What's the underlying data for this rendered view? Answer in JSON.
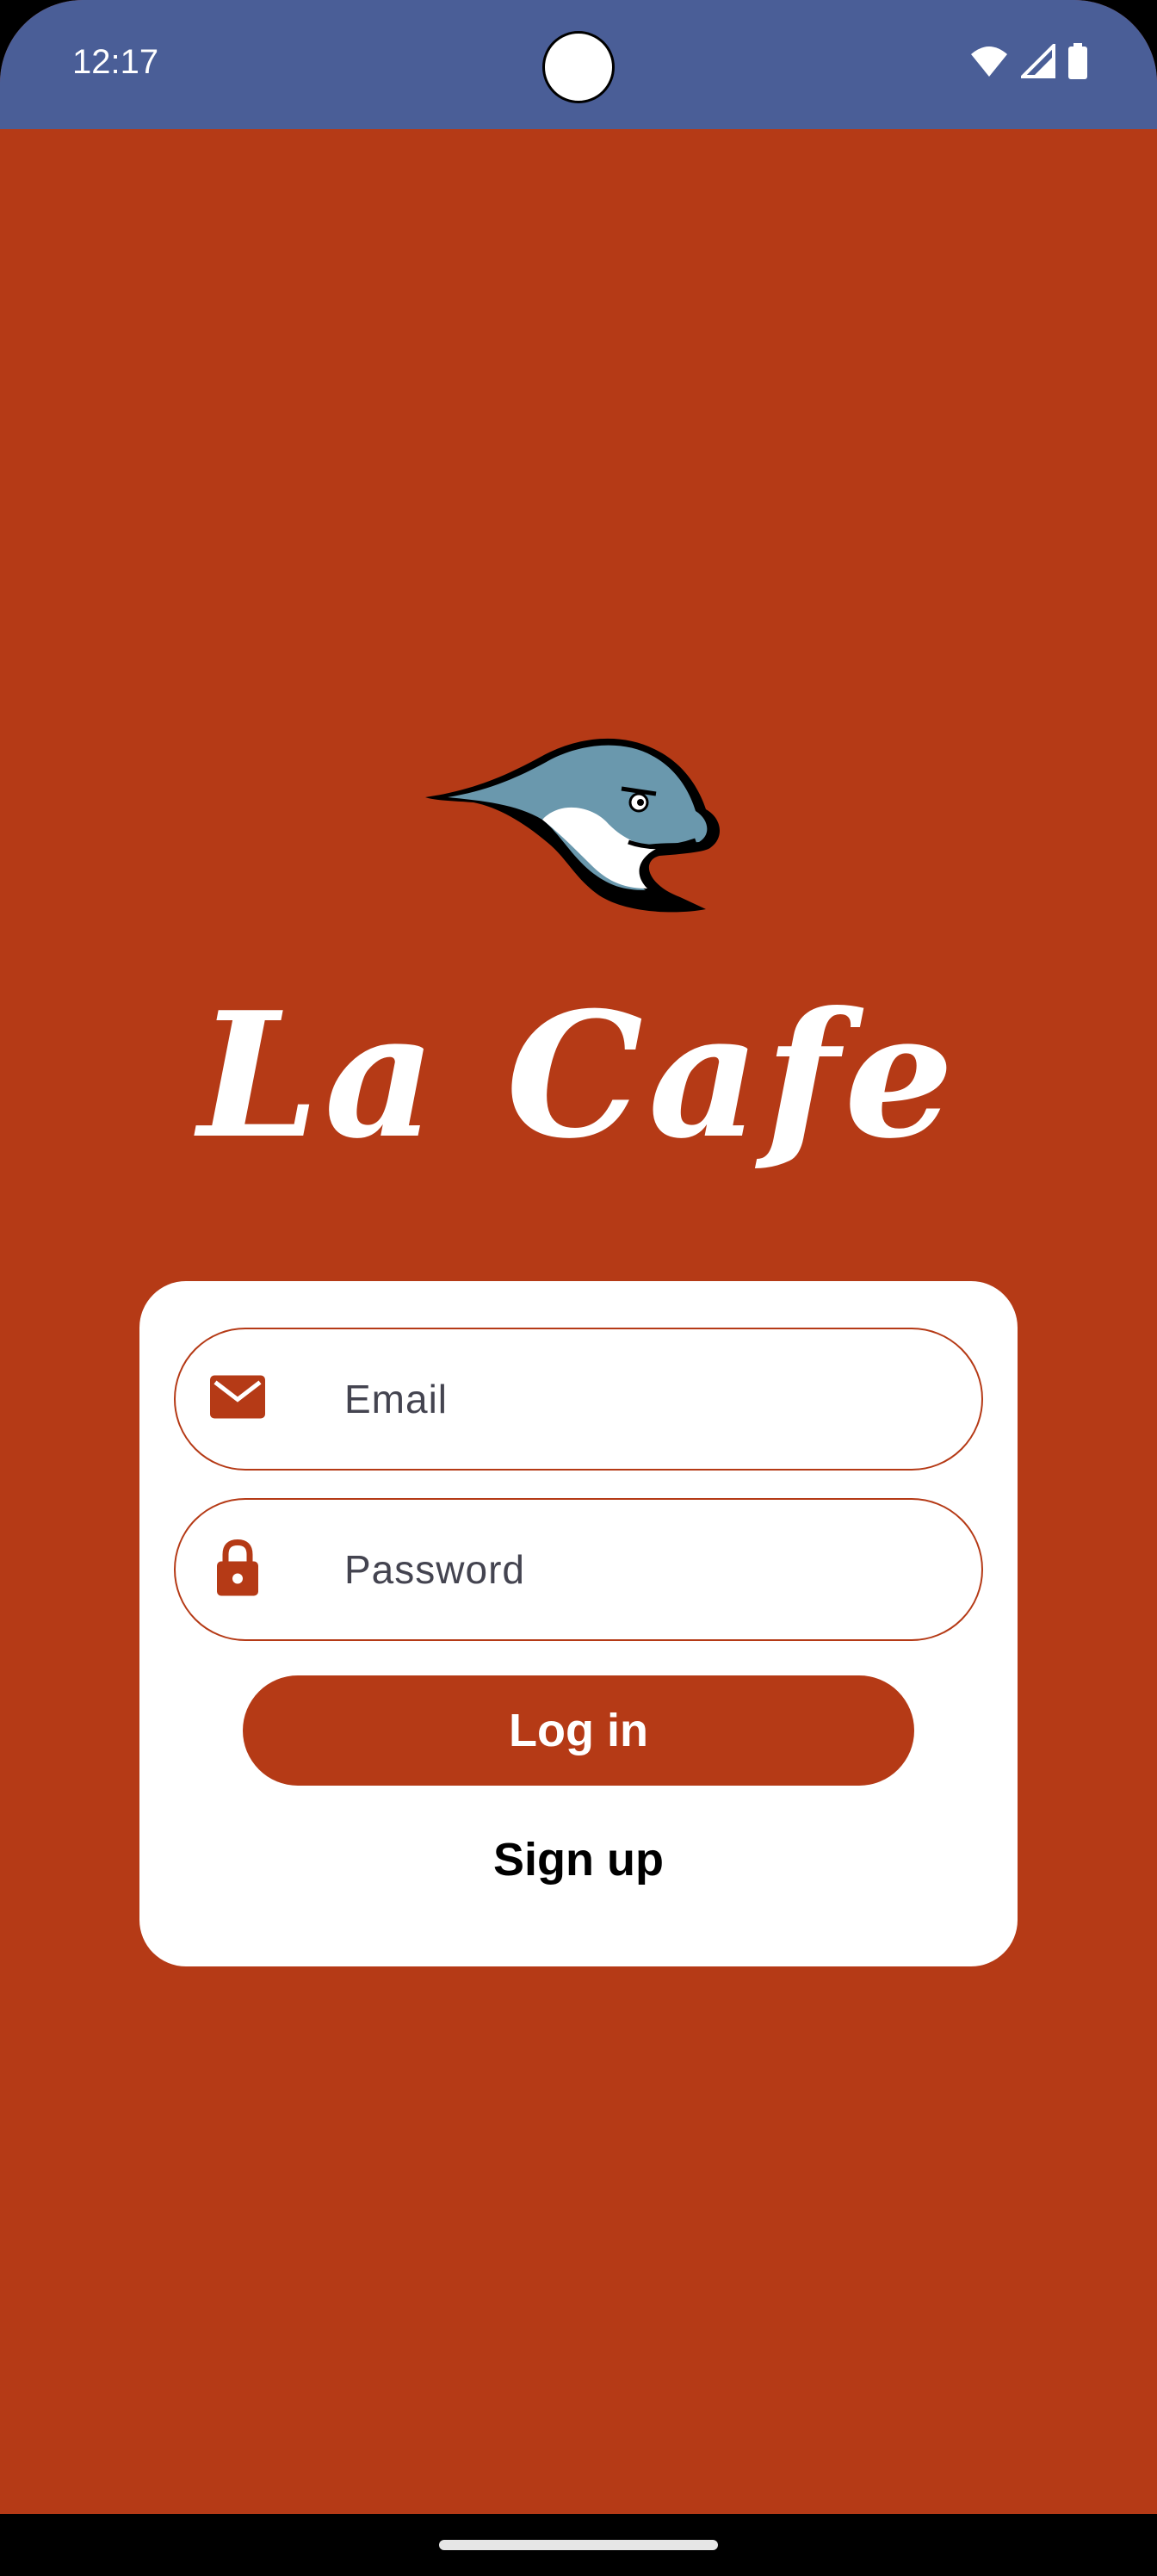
{
  "status_bar": {
    "time": "12:17",
    "icons": [
      "wifi-icon",
      "signal-icon",
      "battery-icon"
    ]
  },
  "colors": {
    "background": "#b53a16",
    "status_bar": "#4a5e97",
    "card": "#ffffff",
    "accent": "#b53a16",
    "logo_body": "#6a98ad"
  },
  "app": {
    "title": "La Cafe",
    "logo": "dolphin-logo"
  },
  "login_form": {
    "email": {
      "placeholder": "Email",
      "value": "",
      "icon": "mail-icon"
    },
    "password": {
      "placeholder": "Password",
      "value": "",
      "icon": "lock-icon"
    },
    "login_label": "Log in",
    "signup_label": "Sign up"
  }
}
